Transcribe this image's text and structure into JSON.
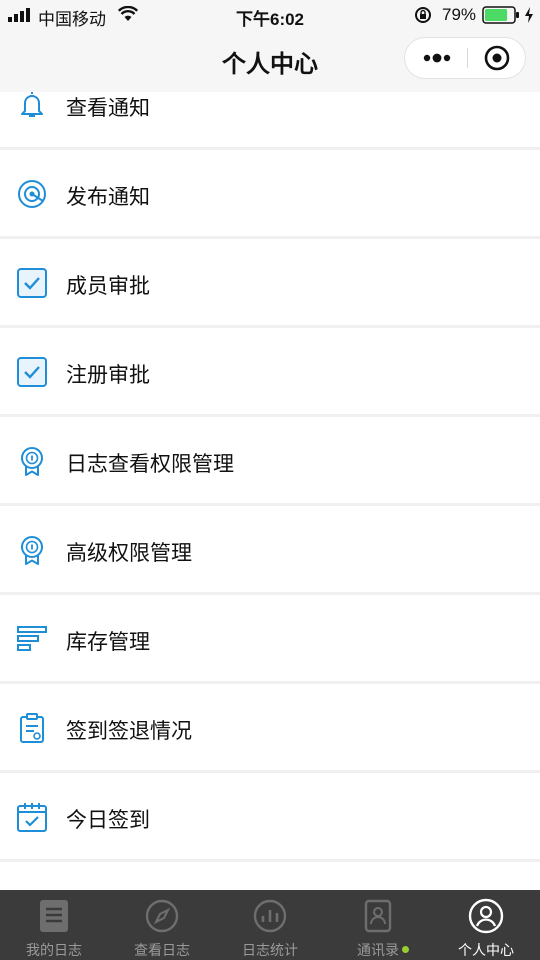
{
  "status_bar": {
    "carrier": "中国移动",
    "time": "下午6:02",
    "battery_percent": "79%",
    "battery_level": 0.79
  },
  "nav": {
    "title": "个人中心"
  },
  "menu": {
    "items": [
      {
        "label": "查看通知",
        "icon": "bell-icon"
      },
      {
        "label": "发布通知",
        "icon": "broadcast-icon"
      },
      {
        "label": "成员审批",
        "icon": "checkbox-icon"
      },
      {
        "label": "注册审批",
        "icon": "checkbox-icon"
      },
      {
        "label": "日志查看权限管理",
        "icon": "badge-icon"
      },
      {
        "label": "高级权限管理",
        "icon": "badge-icon"
      },
      {
        "label": "库存管理",
        "icon": "inventory-icon"
      },
      {
        "label": "签到签退情况",
        "icon": "clipboard-icon"
      },
      {
        "label": "今日签到",
        "icon": "calendar-check-icon"
      }
    ]
  },
  "tab_bar": {
    "tabs": [
      {
        "label": "我的日志",
        "icon": "document-icon",
        "active": false
      },
      {
        "label": "查看日志",
        "icon": "compass-icon",
        "active": false
      },
      {
        "label": "日志统计",
        "icon": "chart-icon",
        "active": false
      },
      {
        "label": "通讯录",
        "icon": "contacts-icon",
        "active": false
      },
      {
        "label": "个人中心",
        "icon": "person-icon",
        "active": true
      }
    ]
  },
  "colors": {
    "accent": "#1f8ed8",
    "header_bg": "#f6f6f6",
    "tab_bar_bg": "#3b3b3b",
    "battery_green": "#4cd964"
  }
}
